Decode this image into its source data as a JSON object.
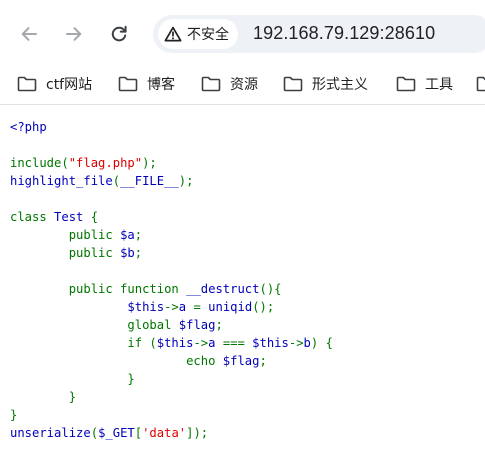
{
  "browser": {
    "security_label": "不安全",
    "url": "192.168.79.129:28610",
    "icons": {
      "back": "back-arrow-icon",
      "forward": "forward-arrow-icon",
      "reload": "reload-icon",
      "security": "warning-triangle-icon",
      "bookmark_folder": "folder-icon"
    }
  },
  "bookmarks": [
    {
      "label": "ctf网站"
    },
    {
      "label": "博客"
    },
    {
      "label": "资源"
    },
    {
      "label": "形式主义"
    },
    {
      "label": "工具"
    }
  ],
  "colors": {
    "php_default": "#0000bb",
    "php_keyword": "#007700",
    "php_string": "#dd0000",
    "security_chip_bg": "#ffffff",
    "omnibox_bg": "#eef1f6"
  },
  "code_lines": [
    [
      {
        "t": "<?php",
        "k": "default"
      }
    ],
    [],
    [
      {
        "t": "include(",
        "k": "keyword"
      },
      {
        "t": "\"flag.php\"",
        "k": "string"
      },
      {
        "t": ");",
        "k": "keyword"
      }
    ],
    [
      {
        "t": "highlight_file",
        "k": "default"
      },
      {
        "t": "(",
        "k": "keyword"
      },
      {
        "t": "__FILE__",
        "k": "default"
      },
      {
        "t": ");",
        "k": "keyword"
      }
    ],
    [],
    [
      {
        "t": "class ",
        "k": "keyword"
      },
      {
        "t": "Test ",
        "k": "default"
      },
      {
        "t": "{",
        "k": "keyword"
      }
    ],
    [
      {
        "t": "        public ",
        "k": "keyword"
      },
      {
        "t": "$a",
        "k": "default"
      },
      {
        "t": ";",
        "k": "keyword"
      }
    ],
    [
      {
        "t": "        public ",
        "k": "keyword"
      },
      {
        "t": "$b",
        "k": "default"
      },
      {
        "t": ";",
        "k": "keyword"
      }
    ],
    [],
    [
      {
        "t": "        public function ",
        "k": "keyword"
      },
      {
        "t": "__destruct",
        "k": "default"
      },
      {
        "t": "(){",
        "k": "keyword"
      }
    ],
    [
      {
        "t": "                ",
        "k": "keyword"
      },
      {
        "t": "$this",
        "k": "default"
      },
      {
        "t": "->",
        "k": "keyword"
      },
      {
        "t": "a ",
        "k": "default"
      },
      {
        "t": "= ",
        "k": "keyword"
      },
      {
        "t": "uniqid",
        "k": "default"
      },
      {
        "t": "();",
        "k": "keyword"
      }
    ],
    [
      {
        "t": "                global ",
        "k": "keyword"
      },
      {
        "t": "$flag",
        "k": "default"
      },
      {
        "t": ";",
        "k": "keyword"
      }
    ],
    [
      {
        "t": "                if (",
        "k": "keyword"
      },
      {
        "t": "$this",
        "k": "default"
      },
      {
        "t": "->",
        "k": "keyword"
      },
      {
        "t": "a ",
        "k": "default"
      },
      {
        "t": "=== ",
        "k": "keyword"
      },
      {
        "t": "$this",
        "k": "default"
      },
      {
        "t": "->",
        "k": "keyword"
      },
      {
        "t": "b",
        "k": "default"
      },
      {
        "t": ") {",
        "k": "keyword"
      }
    ],
    [
      {
        "t": "                        echo ",
        "k": "keyword"
      },
      {
        "t": "$flag",
        "k": "default"
      },
      {
        "t": ";",
        "k": "keyword"
      }
    ],
    [
      {
        "t": "                }",
        "k": "keyword"
      }
    ],
    [
      {
        "t": "        }",
        "k": "keyword"
      }
    ],
    [
      {
        "t": "}",
        "k": "keyword"
      }
    ],
    [
      {
        "t": "unserialize",
        "k": "default"
      },
      {
        "t": "(",
        "k": "keyword"
      },
      {
        "t": "$_GET",
        "k": "default"
      },
      {
        "t": "[",
        "k": "keyword"
      },
      {
        "t": "'data'",
        "k": "string"
      },
      {
        "t": "]);",
        "k": "keyword"
      }
    ]
  ]
}
